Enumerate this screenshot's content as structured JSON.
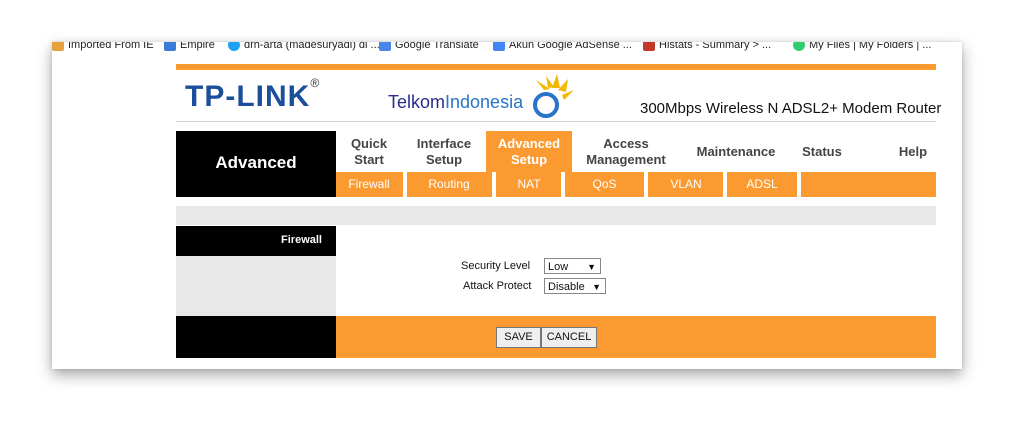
{
  "bookmarks": [
    {
      "label": "Imported From IE",
      "icon": "folder-icon",
      "color": "#e6a23c"
    },
    {
      "label": "Empire",
      "icon": "empire-icon",
      "color": "#3a7bd5"
    },
    {
      "label": "drh-arta (madesuryadi) di ...",
      "icon": "twitter-icon",
      "color": "#1da1f2"
    },
    {
      "label": "Google Translate",
      "icon": "translate-icon",
      "color": "#4a86e8"
    },
    {
      "label": "Akun Google AdSense ...",
      "icon": "google-icon",
      "color": "#4285f4"
    },
    {
      "label": "Histats - Summary > ...",
      "icon": "histats-icon",
      "color": "#c0392b"
    },
    {
      "label": "My Files | My Folders | ...",
      "icon": "files-icon",
      "color": "#2ecc71"
    }
  ],
  "header": {
    "brand": "TP-LINK",
    "brand_reg": "®",
    "partner_1": "Telkom",
    "partner_2": "Indonesia",
    "product": "300Mbps Wireless N ADSL2+ Modem Router"
  },
  "section_title": "Advanced",
  "menu": {
    "quick_setup_1": "Quick",
    "quick_setup_2": "Start",
    "interface_1": "Interface",
    "interface_2": "Setup",
    "advanced_1": "Advanced",
    "advanced_2": "Setup",
    "access_1": "Access",
    "access_2": "Management",
    "maintenance": "Maintenance",
    "status": "Status",
    "help": "Help"
  },
  "submenu": {
    "firewall": "Firewall",
    "routing": "Routing",
    "nat": "NAT",
    "qos": "QoS",
    "vlan": "VLAN",
    "adsl": "ADSL"
  },
  "panel": {
    "firewall_label": "Firewall",
    "security_level_label": "Security Level",
    "security_level_value": "Low",
    "attack_protect_label": "Attack Protect",
    "attack_protect_value": "Disable"
  },
  "buttons": {
    "save": "SAVE",
    "cancel": "CANCEL"
  },
  "colors": {
    "accent": "#fb9a31",
    "brand_blue": "#1b4f9c"
  }
}
